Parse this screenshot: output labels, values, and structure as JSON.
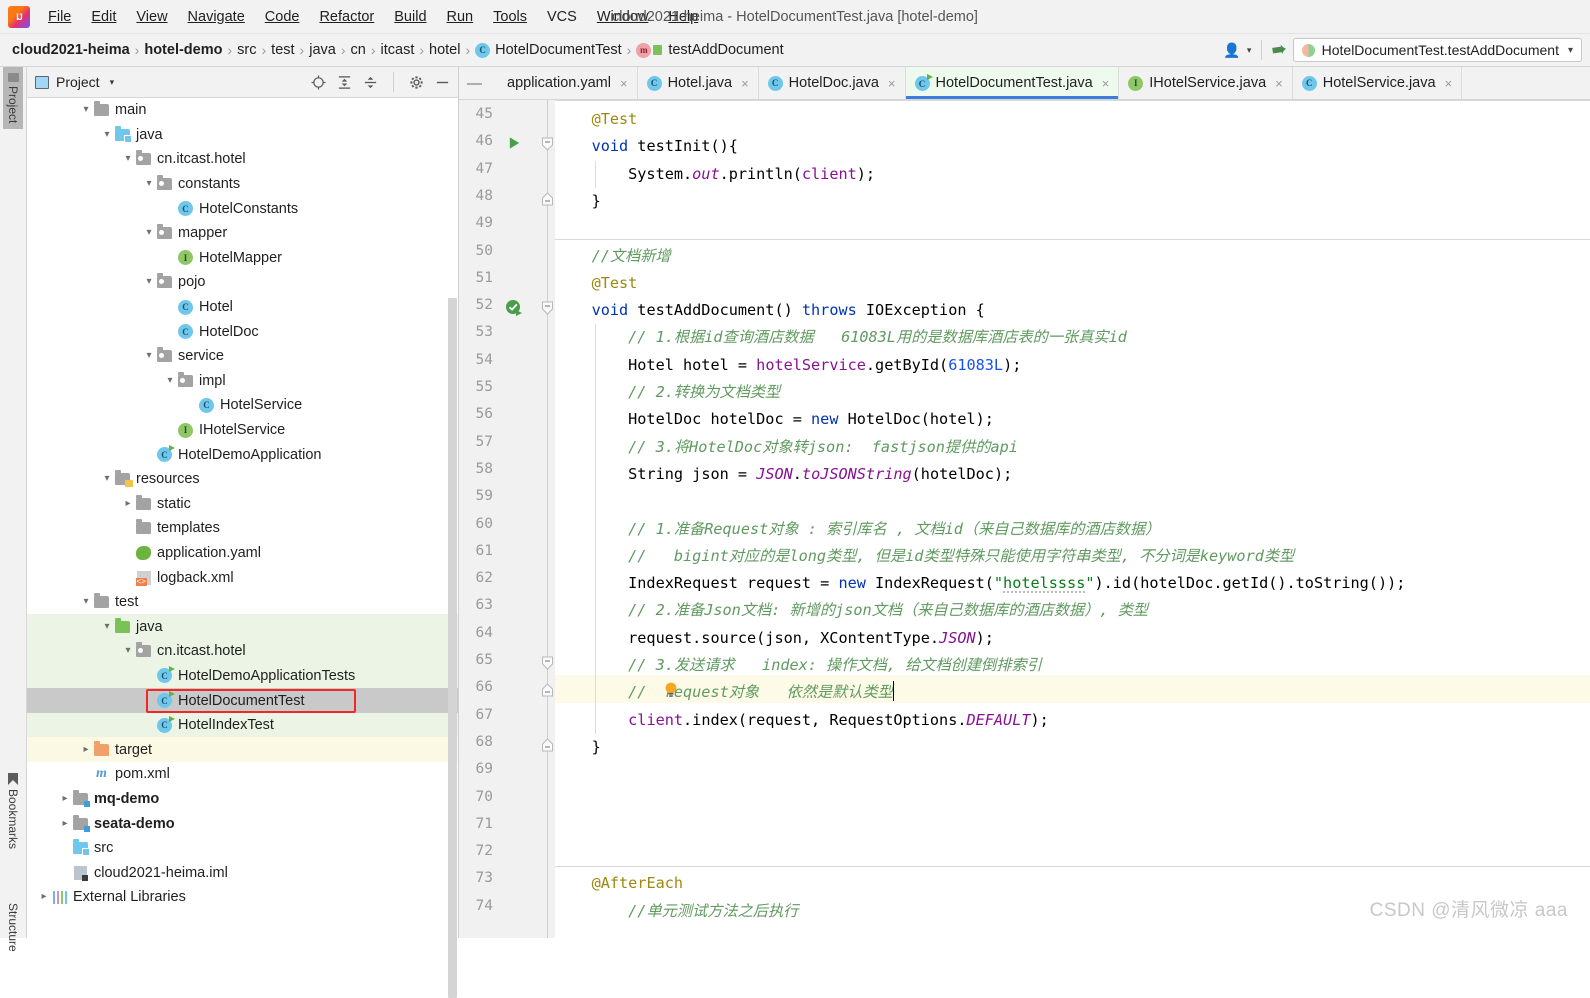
{
  "window": {
    "title": "cloud2021-heima - HotelDocumentTest.java [hotel-demo]",
    "logo_icon": "intellij-idea-logo"
  },
  "menubar": {
    "items": [
      {
        "label": "File"
      },
      {
        "label": "Edit"
      },
      {
        "label": "View"
      },
      {
        "label": "Navigate"
      },
      {
        "label": "Code"
      },
      {
        "label": "Refactor"
      },
      {
        "label": "Build"
      },
      {
        "label": "Run"
      },
      {
        "label": "Tools"
      },
      {
        "label": "VCS"
      },
      {
        "label": "Window"
      },
      {
        "label": "Help"
      }
    ]
  },
  "breadcrumb": {
    "items": [
      {
        "label": "cloud2021-heima",
        "bold": true
      },
      {
        "label": "hotel-demo",
        "bold": true
      },
      {
        "label": "src",
        "bold": false
      },
      {
        "label": "test",
        "bold": false
      },
      {
        "label": "java",
        "bold": false
      },
      {
        "label": "cn",
        "bold": false
      },
      {
        "label": "itcast",
        "bold": false
      },
      {
        "label": "hotel",
        "bold": false
      },
      {
        "label": "HotelDocumentTest",
        "bold": false,
        "icon": "class-icon"
      },
      {
        "label": "testAddDocument",
        "bold": false,
        "icon": "method-icon"
      }
    ]
  },
  "navbar_right": {
    "account_icon": "person-icon",
    "account_caret": "▾",
    "vcs_update_icon": "update-project-icon",
    "run_config": {
      "icon": "run-config-split-icon",
      "label": "HotelDocumentTest.testAddDocument",
      "caret": "▾"
    }
  },
  "toolstrip": {
    "buttons": [
      {
        "label": "Project",
        "icon": "project-folder-icon",
        "active": true
      },
      {
        "label": "Bookmarks",
        "icon": "bookmark-icon",
        "active": false
      },
      {
        "label": "Structure",
        "icon": "structure-icon",
        "active": false
      }
    ]
  },
  "project_panel": {
    "title": "Project",
    "title_icon": "project-window-icon",
    "title_caret": "▾",
    "tools": [
      {
        "name": "locate-icon"
      },
      {
        "name": "expand-all-icon"
      },
      {
        "name": "collapse-all-icon"
      },
      {
        "name": "gear-icon"
      },
      {
        "name": "hide-icon"
      }
    ],
    "tree": [
      {
        "label": "main",
        "indent": 2,
        "arrow": "v",
        "icon": "folder-gray",
        "row": "plain"
      },
      {
        "label": "java",
        "indent": 3,
        "arrow": "v",
        "icon": "folder-blue",
        "row": "plain"
      },
      {
        "label": "cn.itcast.hotel",
        "indent": 4,
        "arrow": "v",
        "icon": "package",
        "row": "plain"
      },
      {
        "label": "constants",
        "indent": 5,
        "arrow": "v",
        "icon": "package",
        "row": "plain"
      },
      {
        "label": "HotelConstants",
        "indent": 6,
        "arrow": "",
        "icon": "class",
        "row": "plain"
      },
      {
        "label": "mapper",
        "indent": 5,
        "arrow": "v",
        "icon": "package",
        "row": "plain"
      },
      {
        "label": "HotelMapper",
        "indent": 6,
        "arrow": "",
        "icon": "interface",
        "row": "plain"
      },
      {
        "label": "pojo",
        "indent": 5,
        "arrow": "v",
        "icon": "package",
        "row": "plain"
      },
      {
        "label": "Hotel",
        "indent": 6,
        "arrow": "",
        "icon": "class",
        "row": "plain"
      },
      {
        "label": "HotelDoc",
        "indent": 6,
        "arrow": "",
        "icon": "class",
        "row": "plain"
      },
      {
        "label": "service",
        "indent": 5,
        "arrow": "v",
        "icon": "package",
        "row": "plain"
      },
      {
        "label": "impl",
        "indent": 6,
        "arrow": "v",
        "icon": "package",
        "row": "plain"
      },
      {
        "label": "HotelService",
        "indent": 7,
        "arrow": "",
        "icon": "class",
        "row": "plain"
      },
      {
        "label": "IHotelService",
        "indent": 6,
        "arrow": "",
        "icon": "interface",
        "row": "plain"
      },
      {
        "label": "HotelDemoApplication",
        "indent": 5,
        "arrow": "",
        "icon": "class-run",
        "row": "plain"
      },
      {
        "label": "resources",
        "indent": 3,
        "arrow": "v",
        "icon": "folder-res",
        "row": "plain"
      },
      {
        "label": "static",
        "indent": 4,
        "arrow": ">",
        "icon": "folder-gray",
        "row": "plain"
      },
      {
        "label": "templates",
        "indent": 4,
        "arrow": "",
        "icon": "folder-gray",
        "row": "plain"
      },
      {
        "label": "application.yaml",
        "indent": 4,
        "arrow": "",
        "icon": "spring-yaml",
        "row": "plain"
      },
      {
        "label": "logback.xml",
        "indent": 4,
        "arrow": "",
        "icon": "xml",
        "row": "plain"
      },
      {
        "label": "test",
        "indent": 2,
        "arrow": "v",
        "icon": "folder-gray",
        "row": "plain"
      },
      {
        "label": "java",
        "indent": 3,
        "arrow": "v",
        "icon": "folder-green",
        "row": "green"
      },
      {
        "label": "cn.itcast.hotel",
        "indent": 4,
        "arrow": "v",
        "icon": "package",
        "row": "green"
      },
      {
        "label": "HotelDemoApplicationTests",
        "indent": 5,
        "arrow": "",
        "icon": "class-test",
        "row": "green"
      },
      {
        "label": "HotelDocumentTest",
        "indent": 5,
        "arrow": "",
        "icon": "class-test",
        "row": "sel",
        "highlight_box": true
      },
      {
        "label": "HotelIndexTest",
        "indent": 5,
        "arrow": "",
        "icon": "class-test",
        "row": "green"
      },
      {
        "label": "target",
        "indent": 2,
        "arrow": ">",
        "icon": "folder-orange",
        "row": "yellow"
      },
      {
        "label": "pom.xml",
        "indent": 2,
        "arrow": "",
        "icon": "maven",
        "row": "plain"
      },
      {
        "label": "mq-demo",
        "indent": 1,
        "arrow": ">",
        "icon": "module",
        "row": "plain",
        "bold": true
      },
      {
        "label": "seata-demo",
        "indent": 1,
        "arrow": ">",
        "icon": "module",
        "row": "plain",
        "bold": true
      },
      {
        "label": "src",
        "indent": 1,
        "arrow": "",
        "icon": "folder-blue",
        "row": "plain"
      },
      {
        "label": "cloud2021-heima.iml",
        "indent": 1,
        "arrow": "",
        "icon": "iml",
        "row": "plain"
      },
      {
        "label": "External Libraries",
        "indent": 0,
        "arrow": ">",
        "icon": "library",
        "row": "plain"
      }
    ]
  },
  "editor_tabs": {
    "collapse_icon": "—",
    "tabs": [
      {
        "label": "application.yaml",
        "icon": "spring-yaml",
        "active": false,
        "close": "×"
      },
      {
        "label": "Hotel.java",
        "icon": "class",
        "active": false,
        "close": "×"
      },
      {
        "label": "HotelDoc.java",
        "icon": "class",
        "active": false,
        "close": "×"
      },
      {
        "label": "HotelDocumentTest.java",
        "icon": "class-test",
        "active": true,
        "close": "×"
      },
      {
        "label": "IHotelService.java",
        "icon": "interface",
        "active": false,
        "close": "×"
      },
      {
        "label": "HotelService.java",
        "icon": "class",
        "active": false,
        "close": "×"
      }
    ]
  },
  "editor": {
    "first_line": 45,
    "last_line": 74,
    "gutter_icons": [
      {
        "line": 46,
        "icon": "run-test-green-triangle-icon"
      },
      {
        "line": 52,
        "icon": "run-test-rerun-icon"
      },
      {
        "line": 66,
        "icon": "intention-bulb-icon"
      }
    ],
    "caret_line": 66,
    "lines": {
      "45": "    @Test",
      "46": "    void testInit(){",
      "47": "        System.out.println(client);",
      "48": "    }",
      "49": "",
      "50": "    //文档新增",
      "51": "    @Test",
      "52": "    void testAddDocument() throws IOException {",
      "53": "        // 1.根据id查询酒店数据   61083L用的是数据库酒店表的一张真实id",
      "54": "        Hotel hotel = hotelService.getById(61083L);",
      "55": "        // 2.转换为文档类型",
      "56": "        HotelDoc hotelDoc = new HotelDoc(hotel);",
      "57": "        // 3.将HotelDoc对象转json:  fastjson提供的api",
      "58": "        String json = JSON.toJSONString(hotelDoc);",
      "59": "",
      "60": "        // 1.准备Request对象 : 索引库名 , 文档id（来自己数据库的酒店数据）",
      "61": "        //   bigint对应的是long类型, 但是id类型特殊只能使用字符串类型, 不分词是keyword类型",
      "62": "        IndexRequest request = new IndexRequest(\"hotelssss\").id(hotelDoc.getId().toString());",
      "63": "        // 2.准备Json文档: 新增的json文档（来自己数据库的酒店数据）, 类型",
      "64": "        request.source(json, XContentType.JSON);",
      "65": "        // 3.发送请求   index: 操作文档, 给文档创建倒排索引",
      "66": "        //  request对象   依然是默认类型",
      "67": "        client.index(request, RequestOptions.DEFAULT);",
      "68": "    }",
      "69": "",
      "70": "",
      "71": "",
      "72": "",
      "73": "    @AfterEach",
      "74": "        //单元测试方法之后执行"
    }
  },
  "watermark": {
    "text": "CSDN @清风微凉 aaa"
  },
  "colors": {
    "accent_tab": "#3b7ddd",
    "selection": "#c9c9c9",
    "test_source_bg": "#ecf5e5",
    "excluded_bg": "#fbf8e4",
    "highlight_box": "#ef2929",
    "keyword": "#0033b3",
    "string": "#067d17",
    "number": "#1750eb",
    "comment": "#5f9a5f",
    "annotation": "#9e880d",
    "static_field": "#871094"
  }
}
